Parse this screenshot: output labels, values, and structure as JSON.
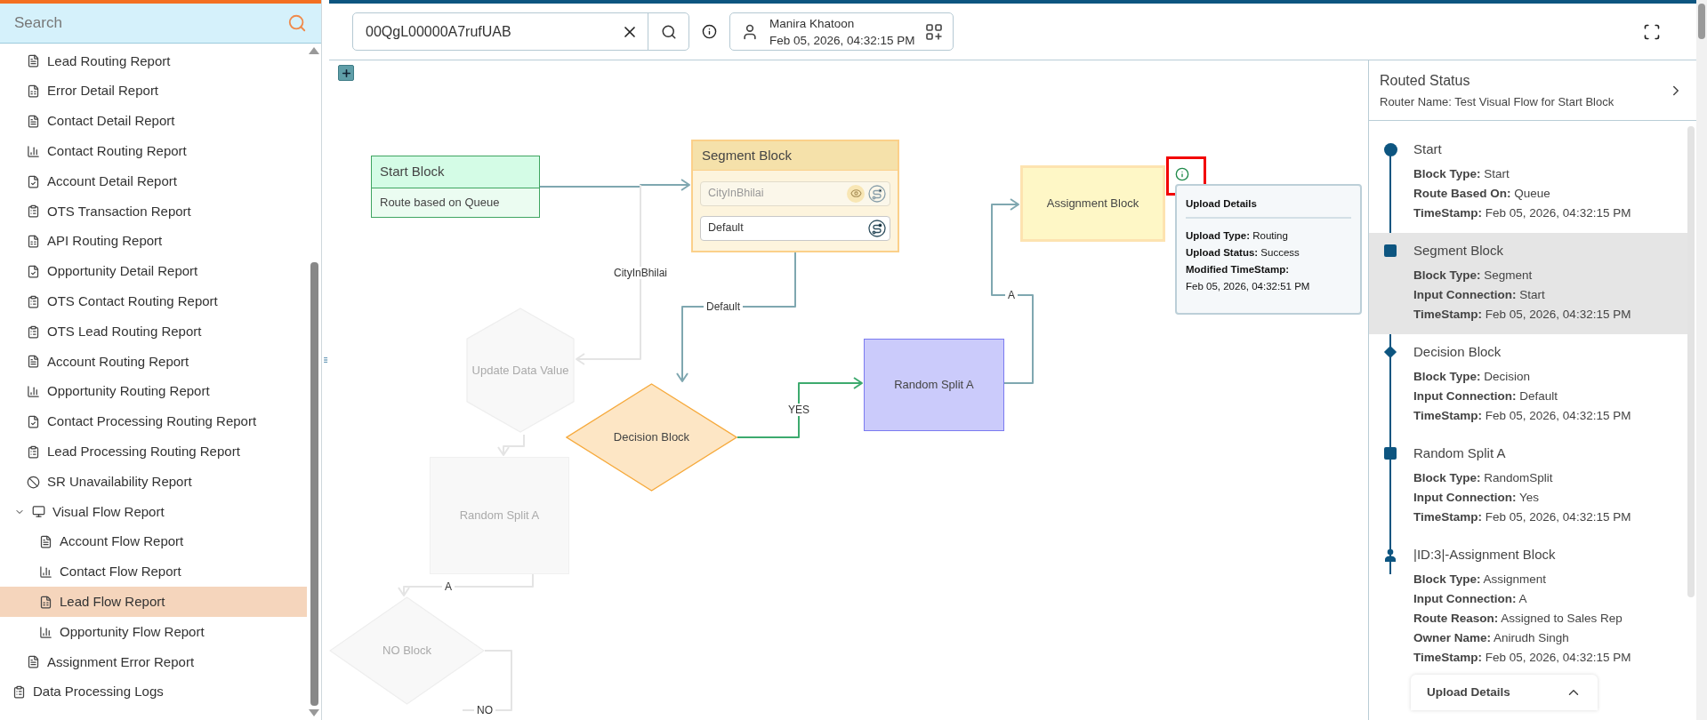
{
  "sidebar": {
    "search": {
      "placeholder": "Search"
    },
    "report_items": [
      {
        "label": "Lead Routing Report",
        "selected": false
      },
      {
        "label": "Error Detail Report",
        "selected": false
      },
      {
        "label": "Contact Detail Report",
        "selected": false
      },
      {
        "label": "Contact Routing Report",
        "selected": false
      },
      {
        "label": "Account Detail Report",
        "selected": false
      },
      {
        "label": "OTS Transaction Report",
        "selected": false
      },
      {
        "label": "API Routing Report",
        "selected": false
      },
      {
        "label": "Opportunity Detail Report",
        "selected": false
      },
      {
        "label": "OTS Contact Routing Report",
        "selected": false
      },
      {
        "label": "OTS Lead Routing Report",
        "selected": false
      },
      {
        "label": "Account Routing Report",
        "selected": false
      },
      {
        "label": "Opportunity Routing Report",
        "selected": false
      },
      {
        "label": "Contact Processing Routing Report",
        "selected": false
      },
      {
        "label": "Lead Processing Routing Report",
        "selected": false
      },
      {
        "label": "SR Unavailability Report",
        "selected": false
      },
      {
        "label": "Visual Flow Report",
        "selected": false,
        "expanded": true,
        "children": [
          {
            "label": "Account Flow Report",
            "selected": false
          },
          {
            "label": "Contact Flow Report",
            "selected": false
          },
          {
            "label": "Lead Flow Report",
            "selected": true
          },
          {
            "label": "Opportunity Flow Report",
            "selected": false
          }
        ]
      },
      {
        "label": "Assignment Error Report",
        "selected": false
      }
    ],
    "root_items": [
      {
        "label": "Data Processing Logs",
        "selected": false
      }
    ]
  },
  "toolbar": {
    "record_search": {
      "value": "00QgL00000A7rufUAB"
    },
    "user": {
      "name": "Manira Khatoon",
      "datetime": "Feb 05, 2026, 04:32:15 PM"
    }
  },
  "flow": {
    "nodes": [
      {
        "kind": "start",
        "title": "Start Block",
        "subtitle": "Route based on Queue",
        "active": true
      },
      {
        "kind": "segment",
        "title": "Segment Block",
        "active": true,
        "rows": [
          {
            "label": "CityInBhilai",
            "active": false
          },
          {
            "label": "Default",
            "active": true
          }
        ]
      },
      {
        "kind": "hexagon",
        "title": "Update Data Value",
        "active": false
      },
      {
        "kind": "diamond",
        "title": "Decision Block",
        "active": true
      },
      {
        "kind": "rect",
        "title": "Random Split A",
        "active": true
      },
      {
        "kind": "assignment",
        "title": "Assignment Block",
        "active": true
      },
      {
        "kind": "rect",
        "title": "Random Split A",
        "active": false
      },
      {
        "kind": "diamond",
        "title": "NO Block",
        "active": false
      }
    ],
    "edges": [
      {
        "color": "#7fa7b0"
      },
      {
        "label": "CityInBhilai",
        "color": "#e4e4e4"
      },
      {
        "label": "Default",
        "color": "#7fa7b0"
      },
      {
        "label": "YES",
        "color": "#3daa6e"
      },
      {
        "label": "A",
        "color": "#7fa7b0"
      },
      {
        "color": "#e4e4e4"
      },
      {
        "label": "A",
        "color": "#e4e4e4"
      },
      {
        "label": "NO",
        "color": "#e4e4e4"
      }
    ],
    "popup": {
      "title": "Upload Details",
      "fields": [
        {
          "label": "Upload Type:",
          "value": "Routing"
        },
        {
          "label": "Upload Status:",
          "value": "Success"
        },
        {
          "label": "Modified TimeStamp:",
          "value": "Feb 05, 2026, 04:32:51 PM"
        }
      ]
    }
  },
  "routed_status": {
    "title": "Routed Status",
    "router_name": "Router Name: Test Visual Flow for Start Block",
    "steps": [
      {
        "kind": "circle",
        "title": "Start",
        "selected": false,
        "fields": [
          {
            "label": "Block Type:",
            "value": "Start"
          },
          {
            "label": "Route Based On:",
            "value": "Queue"
          },
          {
            "label": "TimeStamp:",
            "value": "Feb 05, 2026, 04:32:15 PM"
          }
        ]
      },
      {
        "kind": "square",
        "title": "Segment Block",
        "selected": true,
        "fields": [
          {
            "label": "Block Type:",
            "value": "Segment"
          },
          {
            "label": "Input Connection:",
            "value": "Start"
          },
          {
            "label": "TimeStamp:",
            "value": "Feb 05, 2026, 04:32:15 PM"
          }
        ]
      },
      {
        "kind": "diamond",
        "title": "Decision Block",
        "selected": false,
        "fields": [
          {
            "label": "Block Type:",
            "value": "Decision"
          },
          {
            "label": "Input Connection:",
            "value": "Default"
          },
          {
            "label": "TimeStamp:",
            "value": "Feb 05, 2026, 04:32:15 PM"
          }
        ]
      },
      {
        "kind": "square",
        "title": "Random Split A",
        "selected": false,
        "fields": [
          {
            "label": "Block Type:",
            "value": "RandomSplit"
          },
          {
            "label": "Input Connection:",
            "value": "Yes"
          },
          {
            "label": "TimeStamp:",
            "value": "Feb 05, 2026, 04:32:15 PM"
          }
        ]
      },
      {
        "kind": "person",
        "title": "|ID:3|-Assignment Block",
        "selected": false,
        "fields": [
          {
            "label": "Block Type:",
            "value": "Assignment"
          },
          {
            "label": "Input Connection:",
            "value": "A"
          },
          {
            "label": "Route Reason:",
            "value": "Assigned to Sales Rep"
          },
          {
            "label": "Owner Name:",
            "value": "Anirudh Singh"
          },
          {
            "label": "TimeStamp:",
            "value": "Feb 05, 2026, 04:32:15 PM"
          }
        ],
        "upload_details": {
          "title": "Upload Details"
        }
      }
    ]
  }
}
